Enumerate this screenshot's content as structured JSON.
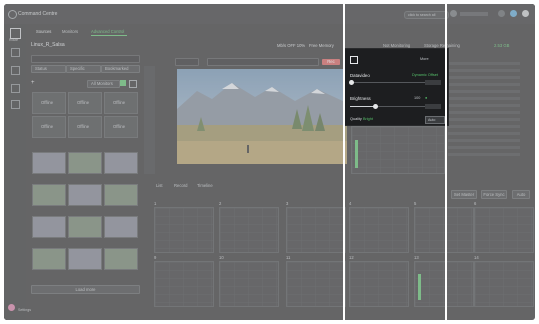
{
  "app": {
    "title": "Command Centre"
  },
  "header": {
    "tabs": [
      "Sources",
      "Monitors",
      "Advanced Control"
    ],
    "search_button": "click to search all"
  },
  "sidebar": {
    "items": [
      "Route"
    ]
  },
  "device": {
    "title": "Linux_R_Salsa",
    "filters": [
      "Status",
      "Specific",
      "Bookmarked"
    ],
    "list_title": "Monitors",
    "list_button": "All Monitors",
    "show_more": "Load more"
  },
  "thumbnails": [
    "Offline",
    "Offline",
    "Offline",
    "Offline",
    "Offline",
    "Offline",
    "Offline",
    "Offline",
    "Offline",
    "Offline",
    "Offline",
    "Offline",
    "Offline",
    "Offline",
    "Offline",
    "Offline",
    "Offline",
    "Offline"
  ],
  "status_bar": {
    "bitrate": "Mb/s OFF  10%",
    "free_memory": "Free Memory",
    "extra": "Not Monitoring",
    "storage": "Storage Remaining",
    "storage_value": "2.53 GB"
  },
  "viewer": {
    "tabs": [
      "List",
      "Record",
      "Timeline"
    ],
    "record_button": "Rec"
  },
  "popup": {
    "menu": "More",
    "datavideo_label": "Datavideo",
    "datavideo_mode": "Dynamic Offset",
    "brightness_label": "Brightness",
    "brightness_value": "100",
    "quality_label": "Quality",
    "quality_value": "Bright",
    "quality_select": "Auto"
  },
  "right_panel": {
    "buttons": [
      "Set Master",
      "Force Sync",
      "Auto"
    ]
  },
  "graphs": {
    "top_row": [
      "1",
      "2",
      "3",
      "4",
      "5",
      "6",
      "7"
    ],
    "bottom_row": [
      "9",
      "10",
      "11",
      "12",
      "13",
      "14",
      "15"
    ]
  },
  "footer": {
    "settings": "Settings"
  },
  "colors": {
    "accent": "#56c06a",
    "dimmer": "#b4b4b4",
    "bg": "#2b2c2e"
  }
}
